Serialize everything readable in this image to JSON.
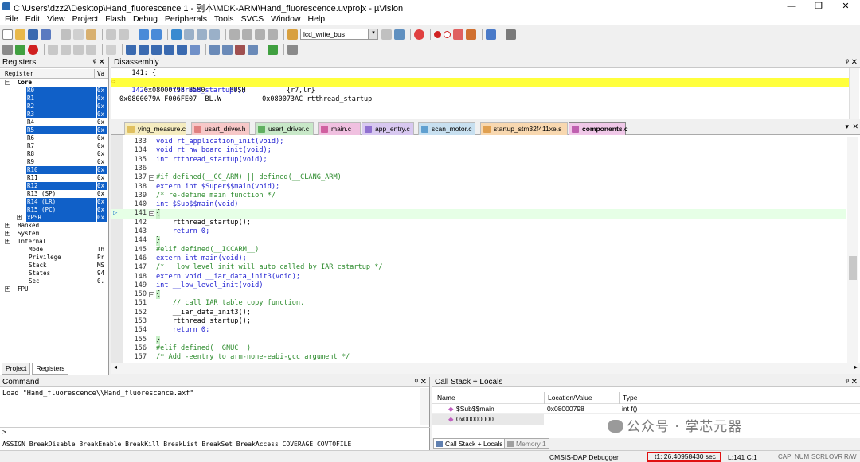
{
  "window": {
    "title": "C:\\Users\\dzz2\\Desktop\\Hand_fluorescence  1 - 副本\\MDK-ARM\\Hand_fluorescence.uvprojx - µVision"
  },
  "menu": [
    "File",
    "Edit",
    "View",
    "Project",
    "Flash",
    "Debug",
    "Peripherals",
    "Tools",
    "SVCS",
    "Window",
    "Help"
  ],
  "toolbar": {
    "target_select": "lcd_write_bus"
  },
  "registers": {
    "title": "Registers",
    "col_register": "Register",
    "col_value": "Va",
    "rows": [
      {
        "name": "Core",
        "value": "",
        "hl": false,
        "bold": true
      },
      {
        "name": "R0",
        "value": "0x",
        "hl": true
      },
      {
        "name": "R1",
        "value": "0x",
        "hl": true
      },
      {
        "name": "R2",
        "value": "0x",
        "hl": true
      },
      {
        "name": "R3",
        "value": "0x",
        "hl": true
      },
      {
        "name": "R4",
        "value": "0x",
        "hl": false
      },
      {
        "name": "R5",
        "value": "0x",
        "hl": true
      },
      {
        "name": "R6",
        "value": "0x",
        "hl": false
      },
      {
        "name": "R7",
        "value": "0x",
        "hl": false
      },
      {
        "name": "R8",
        "value": "0x",
        "hl": false
      },
      {
        "name": "R9",
        "value": "0x",
        "hl": false
      },
      {
        "name": "R10",
        "value": "0x",
        "hl": true
      },
      {
        "name": "R11",
        "value": "0x",
        "hl": false
      },
      {
        "name": "R12",
        "value": "0x",
        "hl": true
      },
      {
        "name": "R13 (SP)",
        "value": "0x",
        "hl": false
      },
      {
        "name": "R14 (LR)",
        "value": "0x",
        "hl": true
      },
      {
        "name": "R15 (PC)",
        "value": "0x",
        "hl": true
      },
      {
        "name": "xPSR",
        "value": "0x",
        "hl": true
      },
      {
        "name": "Banked",
        "value": "",
        "hl": false,
        "top": true
      },
      {
        "name": "System",
        "value": "",
        "hl": false,
        "top": true
      },
      {
        "name": "Internal",
        "value": "",
        "hl": false,
        "top": true
      },
      {
        "name": "Mode",
        "value": "Th",
        "hl": false,
        "sub": true
      },
      {
        "name": "Privilege",
        "value": "Pr",
        "hl": false,
        "sub": true
      },
      {
        "name": "Stack",
        "value": "MS",
        "hl": false,
        "sub": true
      },
      {
        "name": "States",
        "value": "94",
        "hl": false,
        "sub": true
      },
      {
        "name": "Sec",
        "value": "0.",
        "hl": false,
        "sub": true
      },
      {
        "name": "FPU",
        "value": "",
        "hl": false,
        "top": true
      }
    ],
    "tab_project": "Project",
    "tab_registers": "Registers"
  },
  "disassembly": {
    "title": "Disassembly",
    "lines": [
      {
        "text": "   141: {",
        "hl": false
      },
      {
        "text": "0x08000798 B580      PUSH          {r7,lr}",
        "hl": true
      },
      {
        "text": "   142:     rtthread_startup();",
        "hl": false
      },
      {
        "text": "0x0800079A F006FE07  BL.W          0x080073AC rtthread_startup",
        "hl": false
      }
    ]
  },
  "tabs": [
    "ying_measure.c",
    "usart_driver.h",
    "usart_driver.c",
    "main.c",
    "app_entry.c",
    "scan_motor.c",
    "startup_stm32f411xe.s",
    "components.c"
  ],
  "tab_colors": [
    "#f5ecc0",
    "#f7c8c8",
    "#c8e8c8",
    "#f0c0e0",
    "#d8c8f0",
    "#c8e0f0",
    "#f8d8b0",
    "#f0c8e8"
  ],
  "editor": {
    "lines": [
      {
        "n": "133",
        "t": "void rt_application_init(void);",
        "c": "kw"
      },
      {
        "n": "134",
        "t": "void rt_hw_board_init(void);",
        "c": "kw"
      },
      {
        "n": "135",
        "t": "int rtthread_startup(void);",
        "c": "kw"
      },
      {
        "n": "136",
        "t": "",
        "c": ""
      },
      {
        "n": "137",
        "t": "#if defined(__CC_ARM) || defined(__CLANG_ARM)",
        "c": "pp"
      },
      {
        "n": "138",
        "t": "extern int $Super$$main(void);",
        "c": "kw"
      },
      {
        "n": "139",
        "t": "/* re-define main function */",
        "c": "cm"
      },
      {
        "n": "140",
        "t": "int $Sub$$main(void)",
        "c": "kw"
      },
      {
        "n": "141",
        "t": "{",
        "c": ""
      },
      {
        "n": "142",
        "t": "    rtthread_startup();",
        "c": ""
      },
      {
        "n": "143",
        "t": "    return 0;",
        "c": "kw"
      },
      {
        "n": "144",
        "t": "}",
        "c": ""
      },
      {
        "n": "145",
        "t": "#elif defined(__ICCARM__)",
        "c": "pp"
      },
      {
        "n": "146",
        "t": "extern int main(void);",
        "c": "kw"
      },
      {
        "n": "147",
        "t": "/* __low_level_init will auto called by IAR cstartup */",
        "c": "cm"
      },
      {
        "n": "148",
        "t": "extern void __iar_data_init3(void);",
        "c": "kw"
      },
      {
        "n": "149",
        "t": "int __low_level_init(void)",
        "c": "kw"
      },
      {
        "n": "150",
        "t": "{",
        "c": ""
      },
      {
        "n": "151",
        "t": "    // call IAR table copy function.",
        "c": "cm"
      },
      {
        "n": "152",
        "t": "    __iar_data_init3();",
        "c": ""
      },
      {
        "n": "153",
        "t": "    rtthread_startup();",
        "c": ""
      },
      {
        "n": "154",
        "t": "    return 0;",
        "c": "kw"
      },
      {
        "n": "155",
        "t": "}",
        "c": ""
      },
      {
        "n": "156",
        "t": "#elif defined(__GNUC__)",
        "c": "pp"
      },
      {
        "n": "157",
        "t": "/* Add -eentry to arm-none-eabi-gcc argument */",
        "c": "cm"
      }
    ]
  },
  "command": {
    "title": "Command",
    "load_line": "Load \"Hand_fluorescence\\\\Hand_fluorescence.axf\"",
    "prompt": ">",
    "hint": "ASSIGN BreakDisable BreakEnable BreakKill BreakList BreakSet BreakAccess COVERAGE COVTOFILE"
  },
  "callstack": {
    "title": "Call Stack + Locals",
    "col_name": "Name",
    "col_loc": "Location/Value",
    "col_type": "Type",
    "rows": [
      {
        "name": "$Sub$$main",
        "loc": "0x08000798",
        "type": "int f()"
      },
      {
        "name": "0x00000000",
        "loc": "",
        "type": ""
      }
    ],
    "tab1": "Call Stack + Locals",
    "tab2": "Memory 1"
  },
  "watermark": "公众号 · 掌芯元器",
  "status": {
    "debugger": "CMSIS-DAP Debugger",
    "time": "t1: 26.40958430 sec",
    "pos": "L:141 C:1",
    "caps": "CAP",
    "num": "NUM",
    "scrl": "SCRL",
    "ovr": "OVR",
    "rw": "R/W"
  }
}
